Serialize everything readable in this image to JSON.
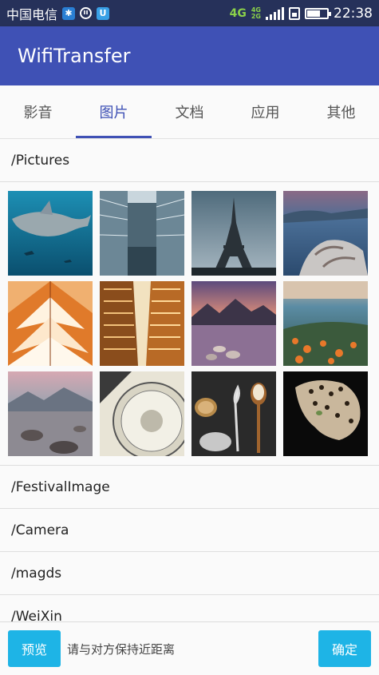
{
  "status_bar": {
    "carrier": "中国电信",
    "network": "4G",
    "network_small_top": "4G",
    "network_small_bottom": "2G",
    "time": "22:38",
    "battery_level": 0.6,
    "icons": [
      "app-notification-icon",
      "sync-icon",
      "shield-icon",
      "signal-icon",
      "sim-icon",
      "battery-icon"
    ]
  },
  "app_bar": {
    "title": "WifiTransfer"
  },
  "tabs": [
    {
      "label": "影音"
    },
    {
      "label": "图片"
    },
    {
      "label": "文档"
    },
    {
      "label": "应用"
    },
    {
      "label": "其他"
    }
  ],
  "active_tab": "图片",
  "folders": {
    "pictures": {
      "path": "/Pictures",
      "thumbnails": [
        "shark-underwater",
        "glass-building",
        "eiffel-tower",
        "driftwood-lake",
        "symmetric-architecture",
        "city-buildings-upward",
        "mountain-lake-sunset",
        "coastal-flowers",
        "mountain-lake-rocks",
        "camera-dial",
        "spoons-spices",
        "leopard"
      ]
    },
    "others": [
      {
        "path": "/FestivalImage"
      },
      {
        "path": "/Camera"
      },
      {
        "path": "/magds"
      },
      {
        "path": "/WeiXin"
      }
    ]
  },
  "bottom_bar": {
    "preview_label": "预览",
    "hint": "请与对方保持近距离",
    "confirm_label": "确定"
  },
  "colors": {
    "primary": "#3f51b5",
    "status_bar": "#26315a",
    "accent_button": "#1eb4e6"
  }
}
